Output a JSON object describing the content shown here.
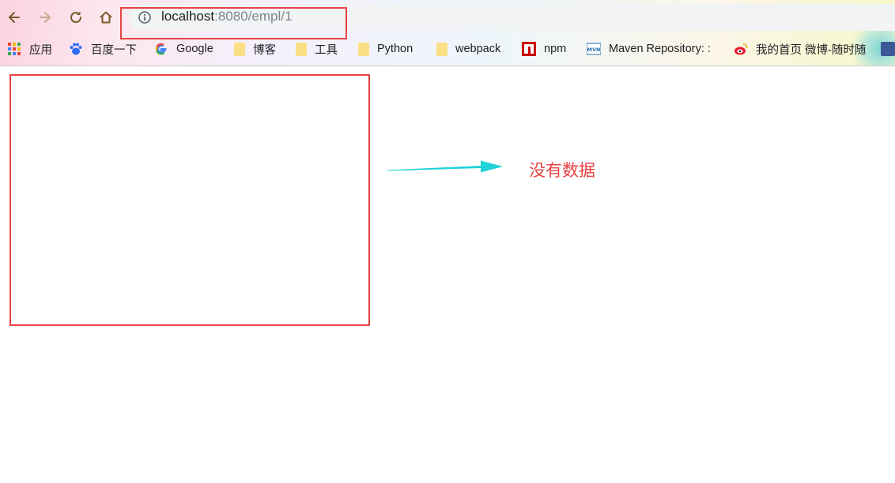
{
  "browser": {
    "url_host": "localhost",
    "url_rest": ":8080/empl/1",
    "bookmarks": [
      {
        "label": "应用",
        "icon": "apps-grid-icon"
      },
      {
        "label": "百度一下",
        "icon": "baidu-paw-icon"
      },
      {
        "label": "Google",
        "icon": "google-icon"
      },
      {
        "label": "博客",
        "icon": "folder-icon"
      },
      {
        "label": "工具",
        "icon": "folder-icon"
      },
      {
        "label": "Python",
        "icon": "folder-icon"
      },
      {
        "label": "webpack",
        "icon": "folder-icon"
      },
      {
        "label": "npm",
        "icon": "npm-icon"
      },
      {
        "label": "Maven Repository: :",
        "icon": "mvn-icon"
      },
      {
        "label": "我的首页 微博-随时随",
        "icon": "weibo-icon"
      }
    ]
  },
  "annotation": {
    "message": "没有数据",
    "accent_red": "#e84343",
    "arrow_color": "#1fd3d8"
  }
}
